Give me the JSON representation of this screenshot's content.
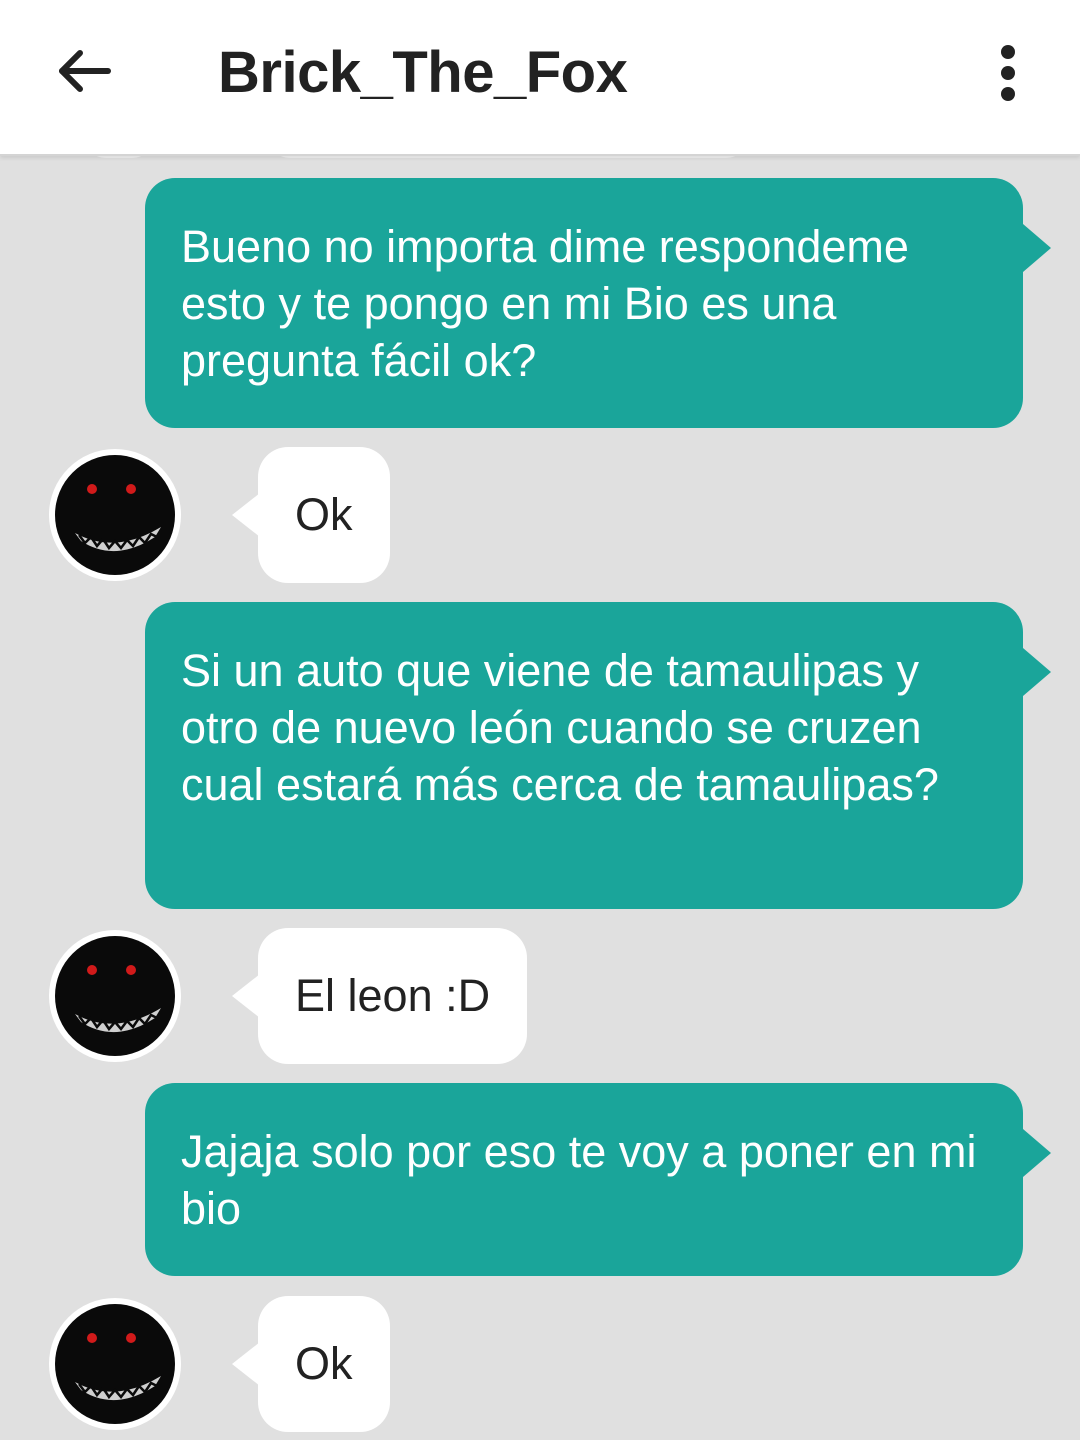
{
  "header": {
    "title": "Brick_The_Fox",
    "back_icon": "arrow-left-icon",
    "menu_icon": "more-vertical-icon"
  },
  "colors": {
    "outgoing_bubble": "#1aa59a",
    "incoming_bubble": "#ffffff",
    "background": "#e0e0e0",
    "header_bg": "#ffffff"
  },
  "messages": [
    {
      "direction": "outgoing",
      "text": "Bueno no importa dime respondeme esto y te pongo en mi Bio es una pregunta fácil ok?"
    },
    {
      "direction": "incoming",
      "text": "Ok"
    },
    {
      "direction": "outgoing",
      "text": "Si un auto que viene de tamaulipas y otro de nuevo león cuando se cruzen cual estará más cerca de tamaulipas?"
    },
    {
      "direction": "incoming",
      "text": "El leon :D"
    },
    {
      "direction": "outgoing",
      "text": "Jajaja solo por eso te voy a poner en mi bio"
    },
    {
      "direction": "incoming",
      "text": "Ok"
    }
  ]
}
